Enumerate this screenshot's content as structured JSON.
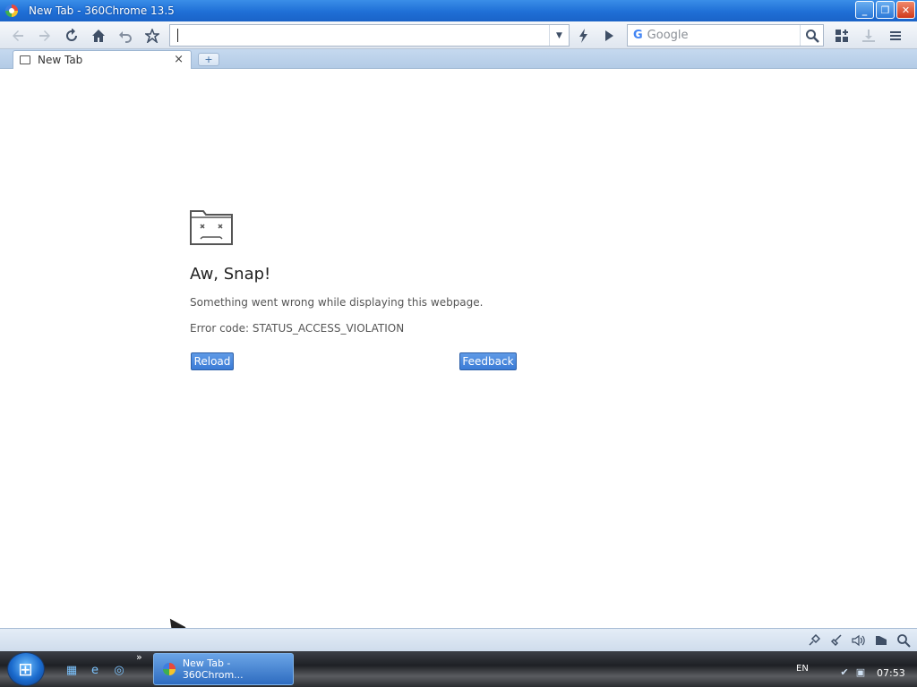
{
  "window": {
    "title": "New Tab - 360Chrome 13.5",
    "controls": {
      "minimize": "_",
      "restore": "❐",
      "close": "✕"
    }
  },
  "toolbar": {
    "address_value": "",
    "search_placeholder": "Google",
    "search_engine_logo": "G"
  },
  "tabs": [
    {
      "label": "New Tab",
      "close": "×"
    }
  ],
  "new_tab_symbol": "+",
  "error_page": {
    "title": "Aw, Snap!",
    "message": "Something went wrong while displaying this webpage.",
    "error_code": "Error code: STATUS_ACCESS_VIOLATION",
    "reload_label": "Reload",
    "feedback_label": "Feedback"
  },
  "taskbar": {
    "chevron": "»",
    "task_button_label": "New Tab - 360Chrom...",
    "language": "EN",
    "clock": "07:53"
  },
  "colors": {
    "titlebar": "#1f6fd6",
    "button_blue": "#3b7bd6"
  }
}
